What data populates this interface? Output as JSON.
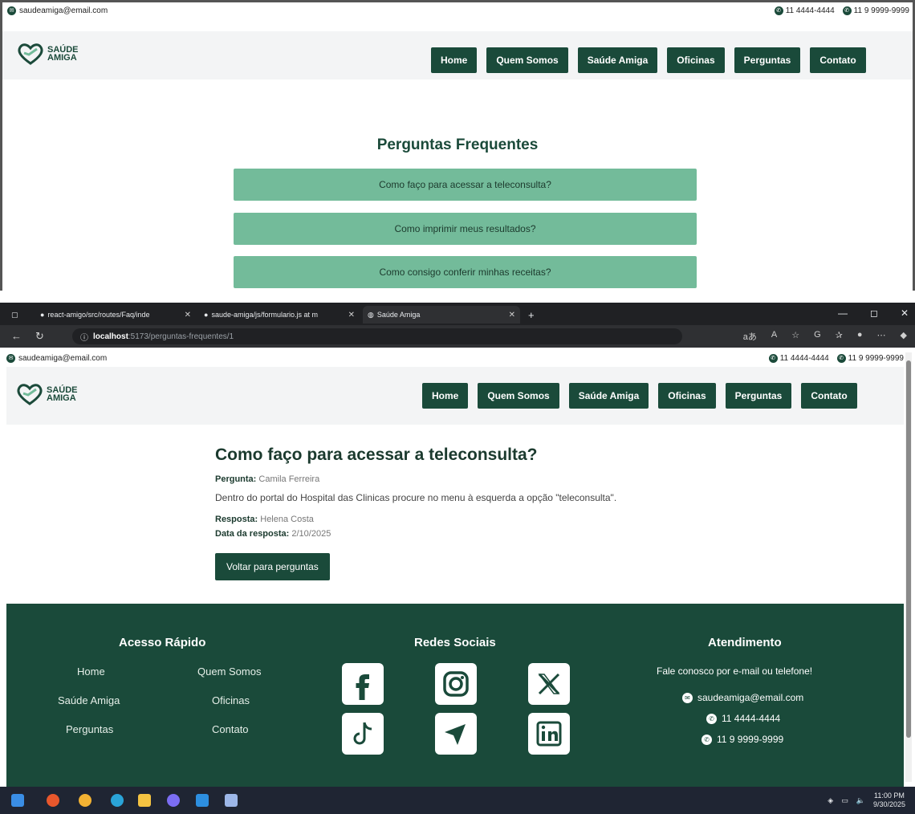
{
  "contact": {
    "email": "saudeamiga@email.com",
    "phone": "11 4444-4444",
    "whatsapp": "11 9 9999-9999"
  },
  "logo": {
    "line1": "SAÚDE",
    "line2": "AMIGA"
  },
  "nav": [
    {
      "label": "Home"
    },
    {
      "label": "Quem Somos"
    },
    {
      "label": "Saúde Amiga"
    },
    {
      "label": "Oficinas"
    },
    {
      "label": "Perguntas"
    },
    {
      "label": "Contato"
    }
  ],
  "faq": {
    "title": "Perguntas Frequentes",
    "items": [
      "Como faço para acessar a teleconsulta?",
      "Como imprimir meus resultados?",
      "Como consigo conferir minhas receitas?"
    ]
  },
  "browser": {
    "tabs": [
      {
        "title": "react-amigo/src/routes/Faq/inde"
      },
      {
        "title": "saude-amiga/js/formulario.js at m"
      },
      {
        "title": "Saúde Amiga"
      }
    ],
    "url_host": "localhost",
    "url_path": ":5173/perguntas-frequentes/1"
  },
  "detail": {
    "title": "Como faço para acessar a teleconsulta?",
    "asked_label": "Pergunta:",
    "asked_by": "Camila Ferreira",
    "body": "Dentro do portal do Hospital das Clinicas procure no menu à esquerda a opção \"teleconsulta\".",
    "answer_label": "Resposta:",
    "answered_by": "Helena Costa",
    "date_label": "Data da resposta:",
    "date": "2/10/2025",
    "back_label": "Voltar para perguntas"
  },
  "footer": {
    "quick_title": "Acesso Rápido",
    "quick_links": [
      "Home",
      "Quem Somos",
      "Saúde Amiga",
      "Oficinas",
      "Perguntas",
      "Contato"
    ],
    "social_title": "Redes Sociais",
    "social_icons": [
      "facebook-icon",
      "instagram-icon",
      "x-icon",
      "tiktok-icon",
      "telegram-icon",
      "linkedin-icon"
    ],
    "service_title": "Atendimento",
    "service_text": "Fale conosco por e-mail ou telefone!"
  },
  "taskbar": {
    "time": "11:00 PM",
    "date": "9/30/2025"
  },
  "colors": {
    "brand": "#1a4a3a",
    "faq_item": "#73bb9a",
    "navbar_bg": "#f3f4f5"
  }
}
